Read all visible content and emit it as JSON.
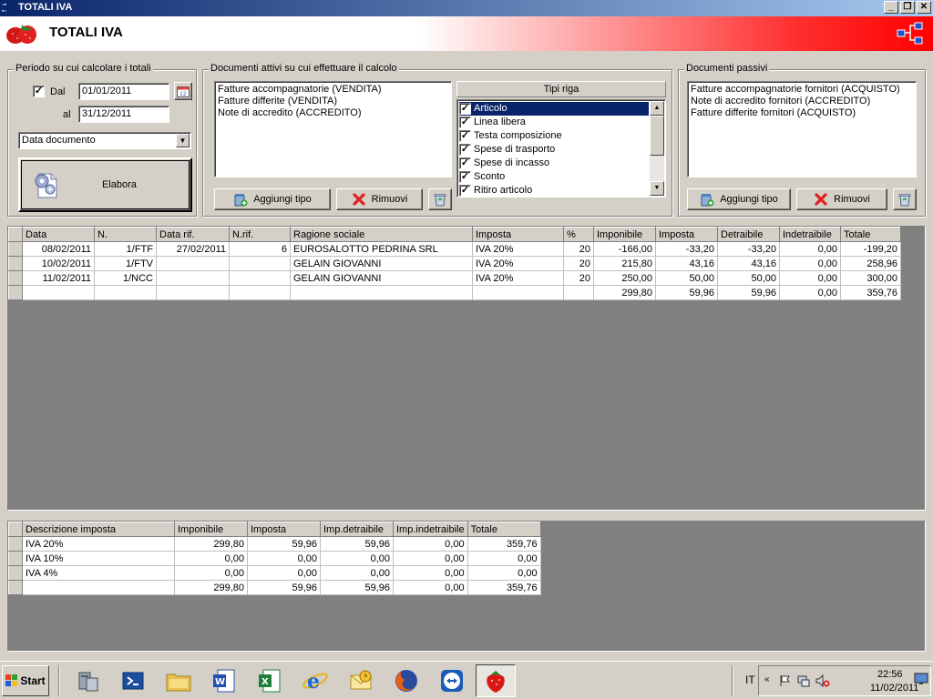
{
  "window": {
    "title": "TOTALI IVA",
    "icon": "app-icon"
  },
  "header": {
    "title": "TOTALI IVA",
    "logo": "strawberry-logo-icon",
    "right_icon": "network-icon",
    "brand_color": "#ff0000"
  },
  "periodo": {
    "legend": "Periodo su cui calcolare i totali",
    "dal_label": "Dal",
    "dal_checked": true,
    "dal_value": "01/01/2011",
    "al_label": "al",
    "al_value": "31/12/2011",
    "date_type": "Data documento",
    "elabora_label": "Elabora"
  },
  "attivi": {
    "legend": "Documenti attivi su cui effettuare il calcolo",
    "documents": [
      "Fatture accompagnatorie (VENDITA)",
      "Fatture differite (VENDITA)",
      "Note di accredito (ACCREDITO)"
    ],
    "tipi_riga_header": "Tipi riga",
    "tipi_riga": [
      {
        "label": "Articolo",
        "checked": true,
        "selected": true
      },
      {
        "label": "Linea libera",
        "checked": true
      },
      {
        "label": "Testa composizione",
        "checked": true
      },
      {
        "label": "Spese di trasporto",
        "checked": true
      },
      {
        "label": "Spese di incasso",
        "checked": true
      },
      {
        "label": "Sconto",
        "checked": true
      },
      {
        "label": "Ritiro articolo",
        "checked": true
      }
    ],
    "aggiungi_label": "Aggiungi tipo",
    "rimuovi_label": "Rimuovi"
  },
  "passivi": {
    "legend": "Documenti passivi",
    "documents": [
      "Fatture accompagnatorie fornitori (ACQUISTO)",
      "Note di accredito fornitori (ACCREDITO)",
      "Fatture differite fornitori (ACQUISTO)"
    ],
    "aggiungi_label": "Aggiungi tipo",
    "rimuovi_label": "Rimuovi"
  },
  "documents_grid": {
    "columns": [
      "Data",
      "N.",
      "Data rif.",
      "N.rif.",
      "Ragione sociale",
      "Imposta",
      "%",
      "Imponibile",
      "Imposta",
      "Detraibile",
      "Indetraibile",
      "Totale"
    ],
    "rows": [
      [
        "08/02/2011",
        "1/FTF",
        "27/02/2011",
        "6",
        "EUROSALOTTO PEDRINA SRL",
        "IVA 20%",
        "20",
        "-166,00",
        "-33,20",
        "-33,20",
        "0,00",
        "-199,20"
      ],
      [
        "10/02/2011",
        "1/FTV",
        "",
        "",
        "GELAIN GIOVANNI",
        "IVA 20%",
        "20",
        "215,80",
        "43,16",
        "43,16",
        "0,00",
        "258,96"
      ],
      [
        "11/02/2011",
        "1/NCC",
        "",
        "",
        "GELAIN GIOVANNI",
        "IVA 20%",
        "20",
        "250,00",
        "50,00",
        "50,00",
        "0,00",
        "300,00"
      ],
      [
        "",
        "",
        "",
        "",
        "",
        "",
        "",
        "299,80",
        "59,96",
        "59,96",
        "0,00",
        "359,76"
      ]
    ]
  },
  "summary_grid": {
    "columns": [
      "Descrizione imposta",
      "Imponibile",
      "Imposta",
      "Imp.detraibile",
      "Imp.indetraibile",
      "Totale"
    ],
    "rows": [
      [
        "IVA 20%",
        "299,80",
        "59,96",
        "59,96",
        "0,00",
        "359,76"
      ],
      [
        "IVA 10%",
        "0,00",
        "0,00",
        "0,00",
        "0,00",
        "0,00"
      ],
      [
        "IVA 4%",
        "0,00",
        "0,00",
        "0,00",
        "0,00",
        "0,00"
      ],
      [
        "",
        "299,80",
        "59,96",
        "59,96",
        "0,00",
        "359,76"
      ]
    ]
  },
  "taskbar": {
    "start_label": "Start",
    "apps": [
      "server-manager-icon",
      "powershell-icon",
      "explorer-icon",
      "word-icon",
      "excel-icon",
      "internet-explorer-icon",
      "outlook-icon",
      "firefox-icon",
      "teamviewer-icon",
      "strawberry-app-icon"
    ],
    "language": "IT",
    "time": "22:56",
    "date": "11/02/2011"
  }
}
